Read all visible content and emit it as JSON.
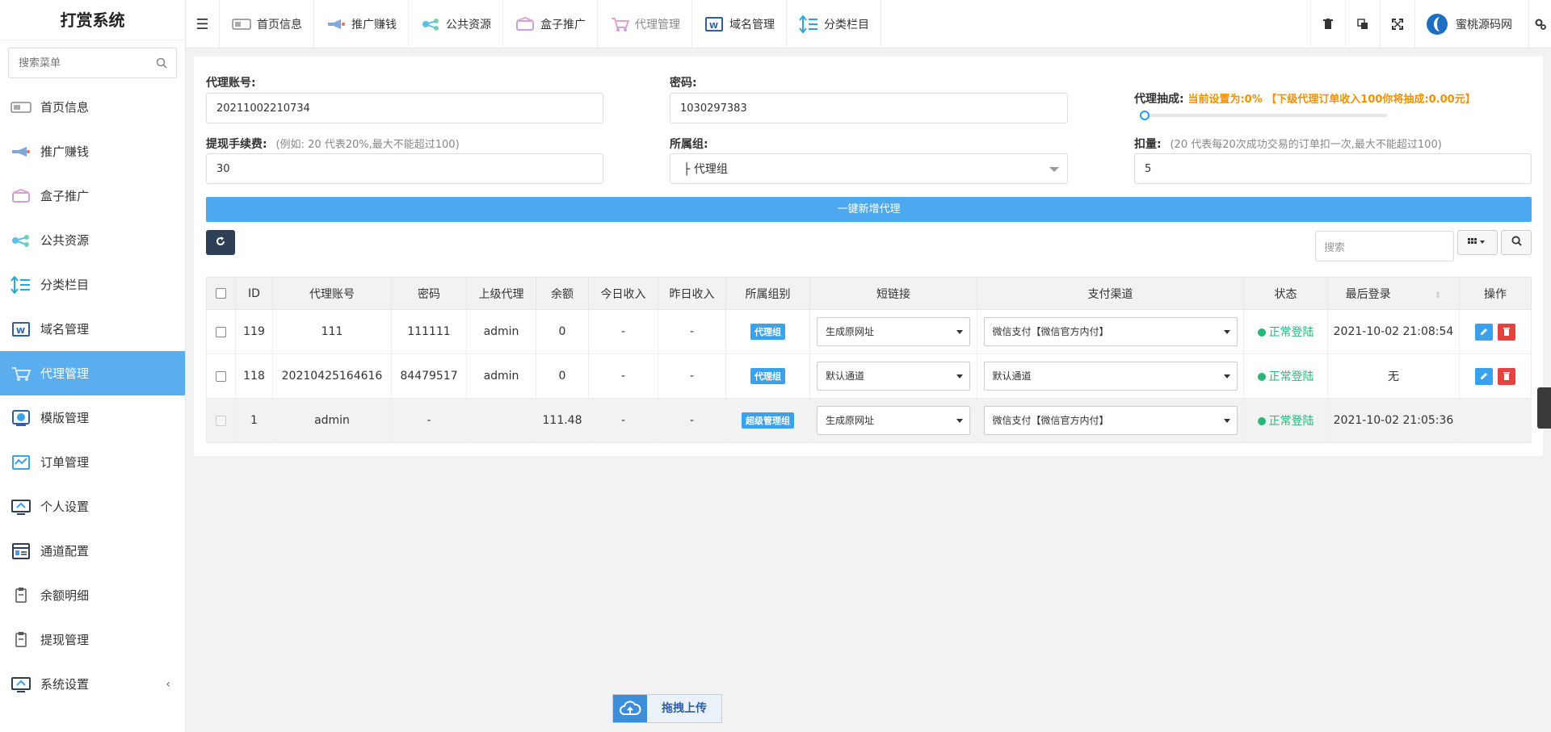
{
  "sidebar": {
    "logo": "打赏系统",
    "search_placeholder": "搜索菜单",
    "items": [
      {
        "label": "首页信息"
      },
      {
        "label": "推广赚钱"
      },
      {
        "label": "盒子推广"
      },
      {
        "label": "公共资源"
      },
      {
        "label": "分类栏目"
      },
      {
        "label": "域名管理"
      },
      {
        "label": "代理管理",
        "active": true
      },
      {
        "label": "模版管理"
      },
      {
        "label": "订单管理"
      },
      {
        "label": "个人设置"
      },
      {
        "label": "通道配置"
      },
      {
        "label": "余额明细"
      },
      {
        "label": "提现管理"
      },
      {
        "label": "系统设置",
        "arrow": "‹"
      }
    ]
  },
  "header": {
    "tabs": [
      {
        "label": "首页信息"
      },
      {
        "label": "推广赚钱"
      },
      {
        "label": "公共资源"
      },
      {
        "label": "盒子推广"
      },
      {
        "label": "代理管理"
      },
      {
        "label": "域名管理"
      },
      {
        "label": "分类栏目"
      }
    ],
    "user_name": "蜜桃源码网"
  },
  "form": {
    "account_label": "代理账号:",
    "account_value": "20211002210734",
    "password_label": "密码:",
    "password_value": "1030297383",
    "commission_label": "代理抽成:",
    "commission_info": "当前设置为:0% 【下级代理订单收入100你将抽成:0.00元】",
    "commission_percent": 0,
    "fee_label": "提现手续费:",
    "fee_hint": "(例如: 20 代表20%,最大不能超过100)",
    "fee_value": "30",
    "group_label": "所属组:",
    "group_value": "├ 代理组",
    "deduct_label": "扣量:",
    "deduct_hint": "(20 代表每20次成功交易的订单扣一次,最大不能超过100)",
    "deduct_value": "5",
    "add_button": "一键新增代理"
  },
  "toolbar": {
    "search_placeholder": "搜索"
  },
  "table": {
    "columns": [
      "ID",
      "代理账号",
      "密码",
      "上级代理",
      "余额",
      "今日收入",
      "昨日收入",
      "所属组别",
      "短链接",
      "支付渠道",
      "状态",
      "最后登录",
      "操作"
    ],
    "rows": [
      {
        "id": "119",
        "account": "111",
        "password": "111111",
        "parent": "admin",
        "balance": "0",
        "today": "-",
        "yesterday": "-",
        "group": "代理组",
        "shortlink": "生成原网址",
        "payment": "微信支付【微信官方内付】",
        "status": "正常登陆",
        "last_login": "2021-10-02 21:08:54"
      },
      {
        "id": "118",
        "account": "20210425164616",
        "password": "84479517",
        "parent": "admin",
        "balance": "0",
        "today": "-",
        "yesterday": "-",
        "group": "代理组",
        "shortlink": "默认通道",
        "payment": "默认通道",
        "status": "正常登陆",
        "last_login": "无"
      },
      {
        "id": "1",
        "account": "admin",
        "password": "-",
        "parent": "",
        "balance": "111.48",
        "today": "-",
        "yesterday": "-",
        "group": "超级管理组",
        "shortlink": "生成原网址",
        "payment": "微信支付【微信官方内付】",
        "status": "正常登陆",
        "last_login": "2021-10-02 21:05:36"
      }
    ]
  },
  "upload": {
    "label": "拖拽上传"
  },
  "colors": {
    "accent": "#5aaef0",
    "status_green": "#28b779",
    "orange": "#f29100",
    "delete_red": "#e64340"
  }
}
